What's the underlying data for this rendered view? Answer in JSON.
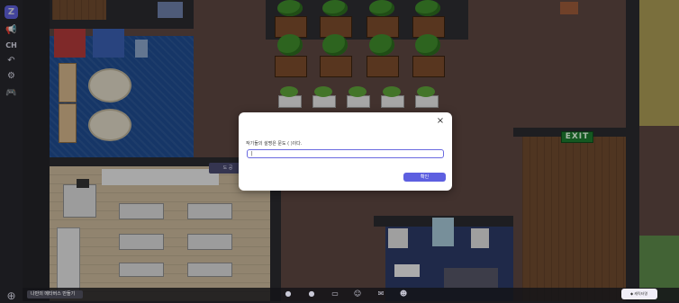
{
  "toolbar": {
    "logo": "Z",
    "items": [
      "megaphone-icon",
      "ch",
      "undo-icon",
      "gear-icon",
      "controller-icon"
    ],
    "ch_label": "CH"
  },
  "world": {
    "exit_sign": "EXIT",
    "bubble_text": "도 공"
  },
  "modal": {
    "label": "작기들의 설명은 문도 ( )이다.",
    "input_value": "|",
    "ok_label": "확인",
    "close_glyph": "×"
  },
  "bottom_bar": {
    "map_button": "나만의 메타버스 만들기",
    "user_chip": "◆ 캐릭터명",
    "labels": [
      "",
      "",
      "",
      "",
      ""
    ]
  },
  "colors": {
    "accent": "#5d5fe0",
    "overlay": "rgba(0,0,0,0.28)"
  }
}
